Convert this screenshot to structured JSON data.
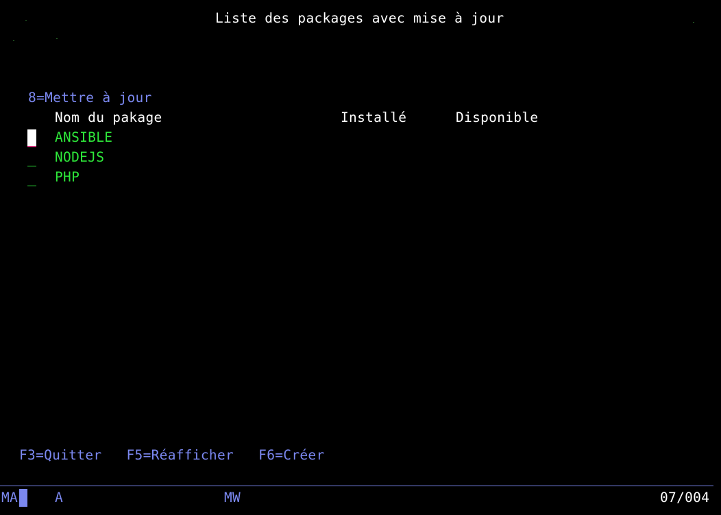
{
  "screen": {
    "title": "Liste des packages avec mise à jour",
    "instructions": "8=Mettre à jour",
    "columns": {
      "name": "Nom du pakage",
      "installed": "Installé",
      "available": "Disponible"
    },
    "rows": [
      {
        "option": "",
        "name": "ANSIBLE"
      },
      {
        "option": "",
        "name": "NODEJS"
      },
      {
        "option": "",
        "name": "PHP"
      }
    ],
    "function_keys": "F3=Quitter   F5=Réafficher   F6=Créer"
  },
  "status_bar": {
    "mode": "MA",
    "indicator": "A",
    "session": "MW",
    "cursor_position": "07/004"
  },
  "colors": {
    "background": "#000000",
    "heading": "#ffffff",
    "info": "#7b88f0",
    "input_field": "#2ee83a"
  }
}
